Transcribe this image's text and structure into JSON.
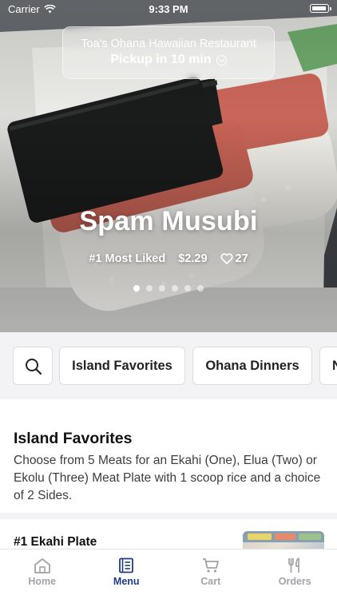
{
  "status_bar": {
    "carrier": "Carrier",
    "time": "9:33 PM"
  },
  "pickup": {
    "restaurant": "Toa's Ohana Hawaiian Restaurant",
    "time_label": "Pickup in 10 min"
  },
  "hero": {
    "title": "Spam Musubi",
    "rank": "#1 Most Liked",
    "price": "$2.29",
    "likes": "27",
    "carousel": {
      "total": 6,
      "active_index": 0
    }
  },
  "categories": {
    "search_icon": "search-icon",
    "chips": [
      "Island Favorites",
      "Ohana Dinners",
      "N"
    ]
  },
  "section": {
    "title": "Island Favorites",
    "description": "Choose from 5 Meats for an Ekahi (One), Elua (Two) or Ekolu (Three) Meat Plate with 1 scoop rice and a choice of 2 Sides."
  },
  "items": [
    {
      "name": "#1 Ekahi Plate"
    }
  ],
  "tab_bar": {
    "tabs": [
      {
        "label": "Home",
        "icon": "home-icon",
        "active": false
      },
      {
        "label": "Menu",
        "icon": "menu-icon",
        "active": true
      },
      {
        "label": "Cart",
        "icon": "cart-icon",
        "active": false
      },
      {
        "label": "Orders",
        "icon": "fork-knife-icon",
        "active": false
      }
    ],
    "active_color": "#1f3c88",
    "inactive_color": "#a3a3a8"
  }
}
